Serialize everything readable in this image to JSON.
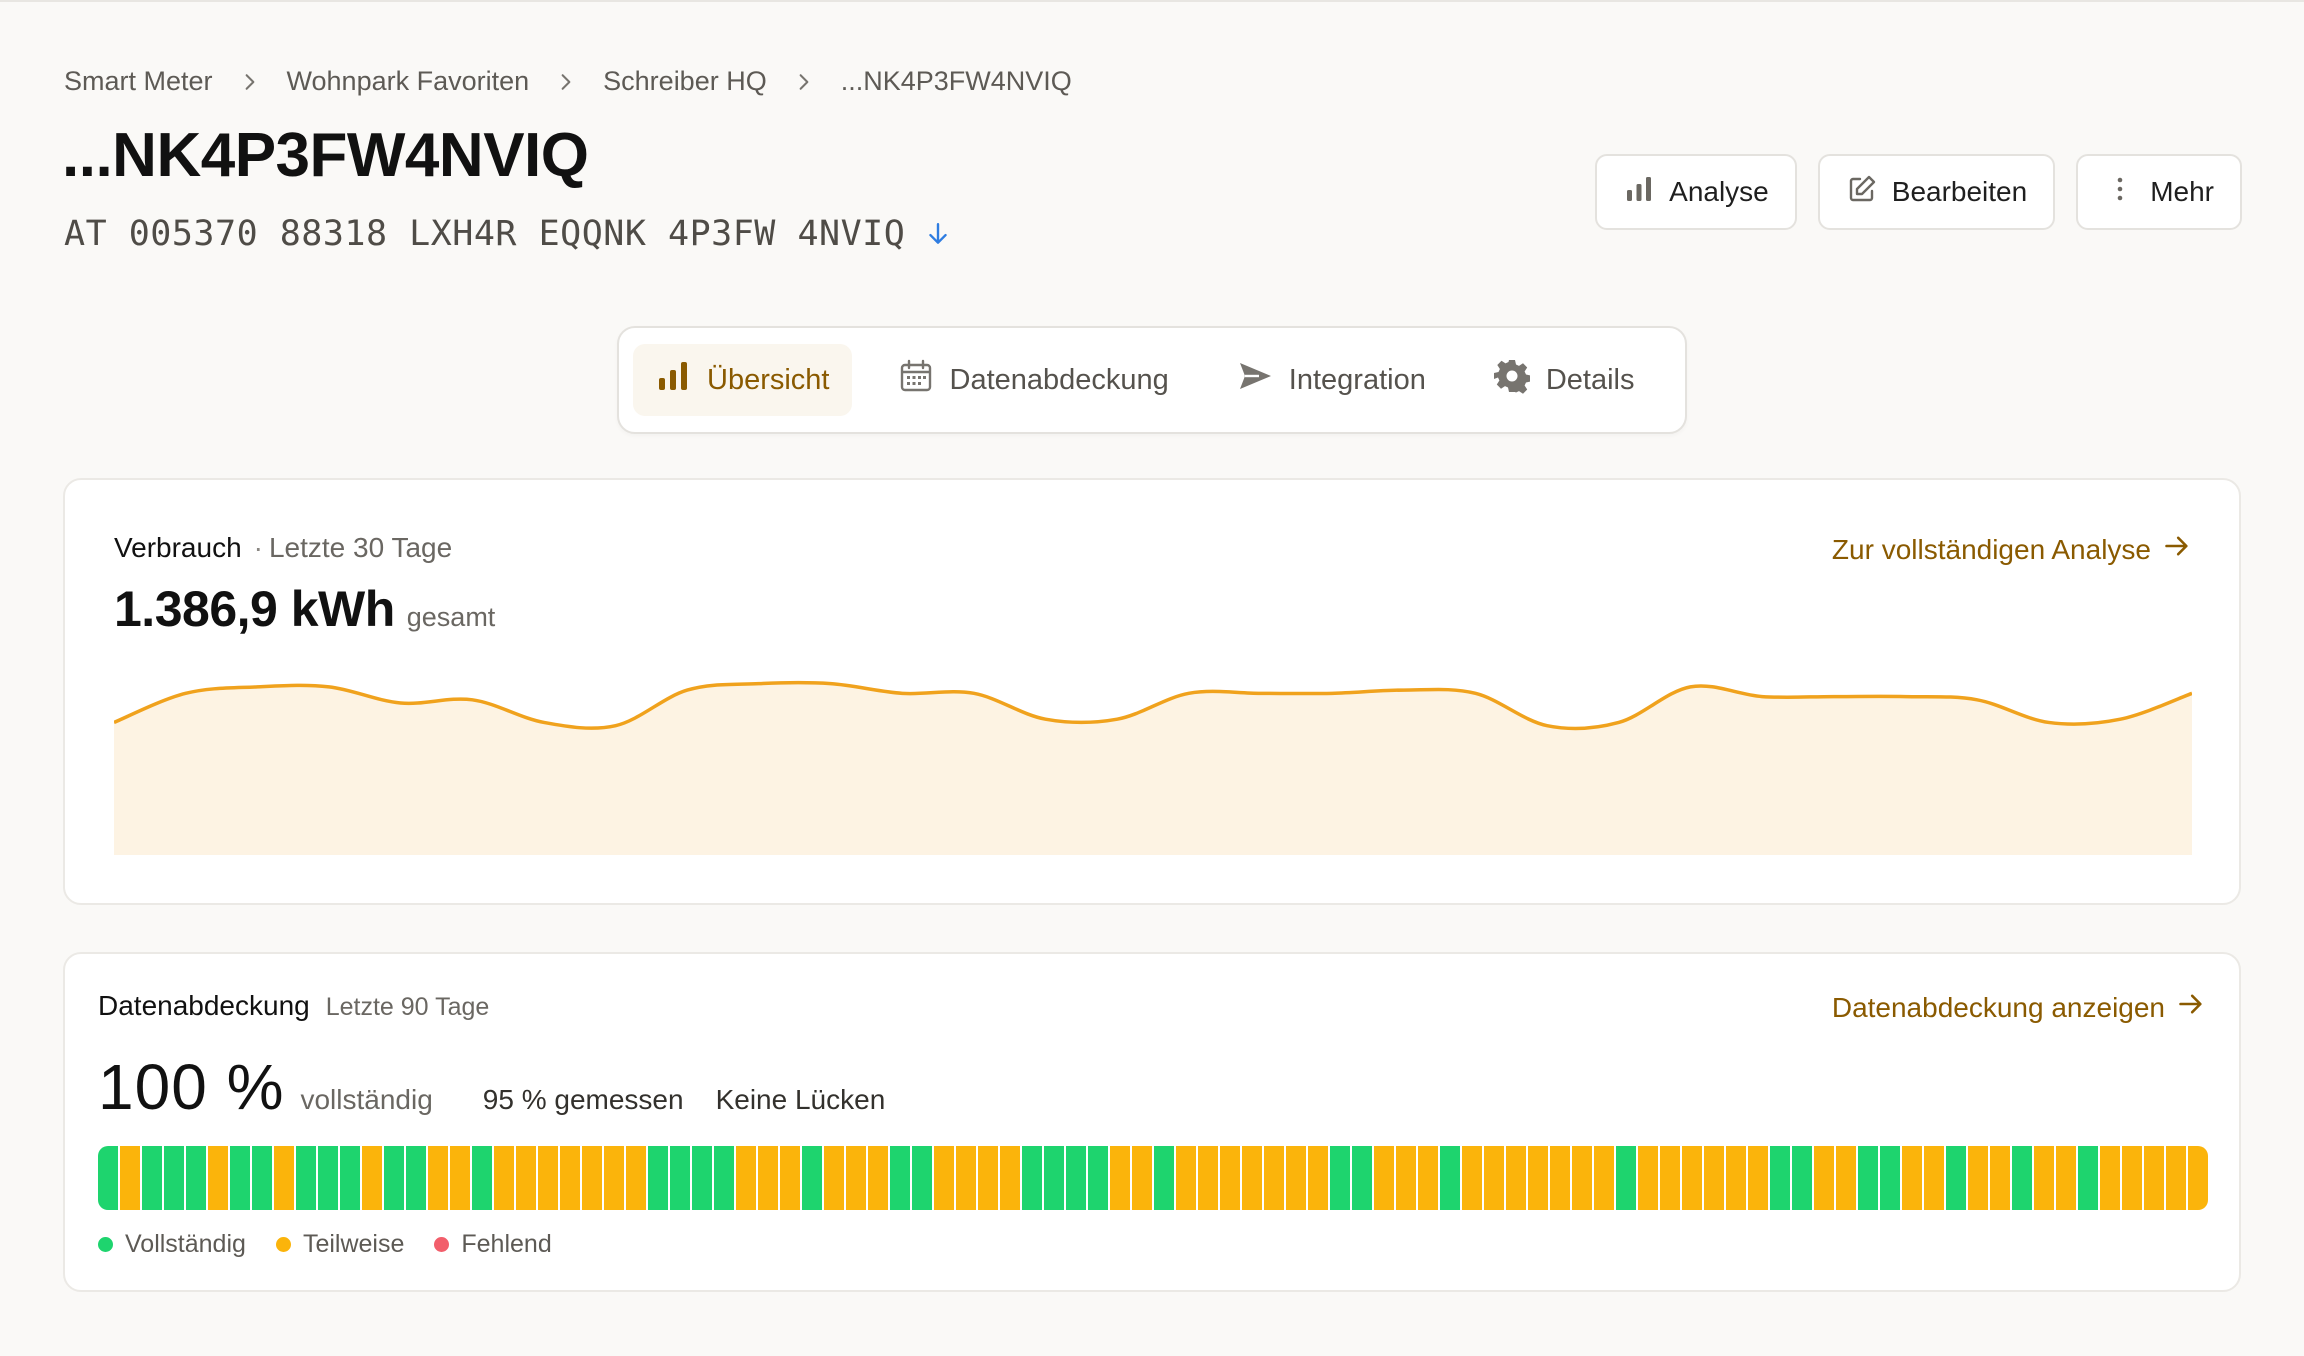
{
  "breadcrumb": [
    "Smart Meter",
    "Wohnpark Favoriten",
    "Schreiber HQ",
    "...NK4P3FW4NVIQ"
  ],
  "title": "...NK4P3FW4NVIQ",
  "meter_id": "AT 005370 88318 LXH4R EQQNK 4P3FW 4NVIQ",
  "actions": {
    "analyse": "Analyse",
    "edit": "Bearbeiten",
    "more": "Mehr"
  },
  "tabs": [
    {
      "label": "Übersicht",
      "icon": "bar-chart-icon",
      "active": true
    },
    {
      "label": "Datenabdeckung",
      "icon": "calendar-icon",
      "active": false
    },
    {
      "label": "Integration",
      "icon": "send-icon",
      "active": false
    },
    {
      "label": "Details",
      "icon": "gear-icon",
      "active": false
    }
  ],
  "consumption": {
    "title": "Verbrauch",
    "separator": "·",
    "period": "Letzte 30 Tage",
    "total_value": "1.386,9 kWh",
    "total_unit": "gesamt",
    "link": "Zur vollständigen Analyse"
  },
  "chart_data": {
    "type": "area",
    "x": [
      1,
      2,
      3,
      4,
      5,
      6,
      7,
      8,
      9,
      10,
      11,
      12,
      13,
      14,
      15,
      16,
      17,
      18,
      19,
      20,
      21,
      22,
      23,
      24,
      25,
      26,
      27,
      28,
      29,
      30
    ],
    "values": [
      41,
      50,
      52,
      52,
      47,
      48,
      41,
      40,
      51,
      53,
      53,
      50,
      50,
      42,
      42,
      50,
      50,
      50,
      51,
      50,
      40,
      41,
      52,
      49,
      49,
      49,
      48,
      41,
      42,
      50
    ],
    "ylim": [
      0,
      60
    ],
    "color": "#f0a21d",
    "fill": "#fdf3e3",
    "grid": false
  },
  "coverage": {
    "title": "Datenabdeckung",
    "period": "Letzte 90 Tage",
    "percent": "100 %",
    "percent_label": "vollständig",
    "measured": "95 % gemessen",
    "gaps": "Keine Lücken",
    "link": "Datenabdeckung anzeigen",
    "days": "CPCCCPCCPCCCPCCPPCPPPPPPPCCCCPPPCPPPCCPPPPCCCCPPCPPPPPPPCCPPPCPPPPPPPCPPPPPPCCPPCCPPCPPCPPCPPPPP",
    "legend": [
      {
        "label": "Vollständig",
        "color": "#1ed46e"
      },
      {
        "label": "Teilweise",
        "color": "#fbb40b"
      },
      {
        "label": "Fehlend",
        "color": "#f25e6b"
      }
    ]
  },
  "colors": {
    "accent": "#8a5a00",
    "complete": "#1ed46e",
    "partial": "#fbb40b",
    "missing": "#f25e6b"
  }
}
